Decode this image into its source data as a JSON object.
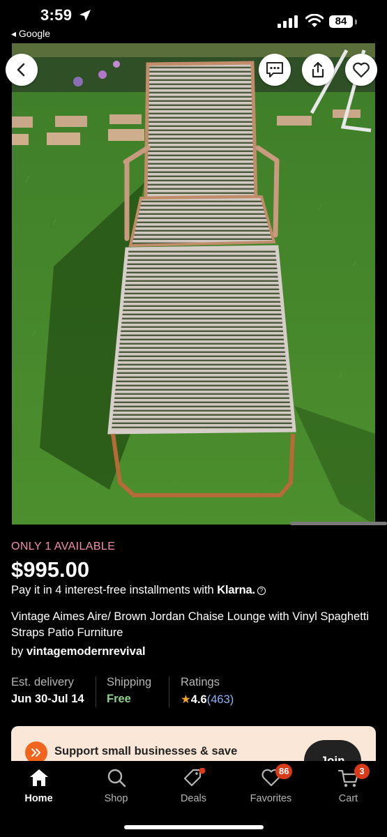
{
  "status_bar": {
    "time": "3:59",
    "back_app": "◂ Google",
    "battery": "84"
  },
  "product": {
    "availability": "ONLY 1 AVAILABLE",
    "price": "$995.00",
    "installments_text": "Pay it in 4 interest-free installments with ",
    "klarna_logo": "Klarna.",
    "title": "Vintage Aimes Aire/ Brown Jordan Chaise Lounge with Vinyl Spaghetti Straps Patio Furniture",
    "seller_prefix": "by ",
    "seller": "vintagemodernrevival"
  },
  "meta": {
    "delivery_label": "Est. delivery",
    "delivery_value": "Jun 30-Jul 14",
    "shipping_label": "Shipping",
    "shipping_value": "Free",
    "ratings_label": "Ratings",
    "rating_value": "4.6",
    "rating_count": "(463)"
  },
  "promo": {
    "text": "Support small businesses & save",
    "button": "Join"
  },
  "tabs": [
    {
      "label": "Home",
      "icon": "home-icon",
      "active": true
    },
    {
      "label": "Shop",
      "icon": "search-icon",
      "active": false
    },
    {
      "label": "Deals",
      "icon": "tag-icon",
      "active": false
    },
    {
      "label": "Favorites",
      "icon": "heart-icon",
      "active": false,
      "badge": "86"
    },
    {
      "label": "Cart",
      "icon": "cart-icon",
      "active": false,
      "badge": "3"
    }
  ],
  "colors": {
    "accent": "#f1641e",
    "availability": "#f48fb1",
    "shipping_free": "#8fd18c",
    "rating_star": "#f5a623",
    "rating_count": "#8ab4f8",
    "badge": "#d93a1a",
    "promo_bg": "#fbe7d7"
  }
}
